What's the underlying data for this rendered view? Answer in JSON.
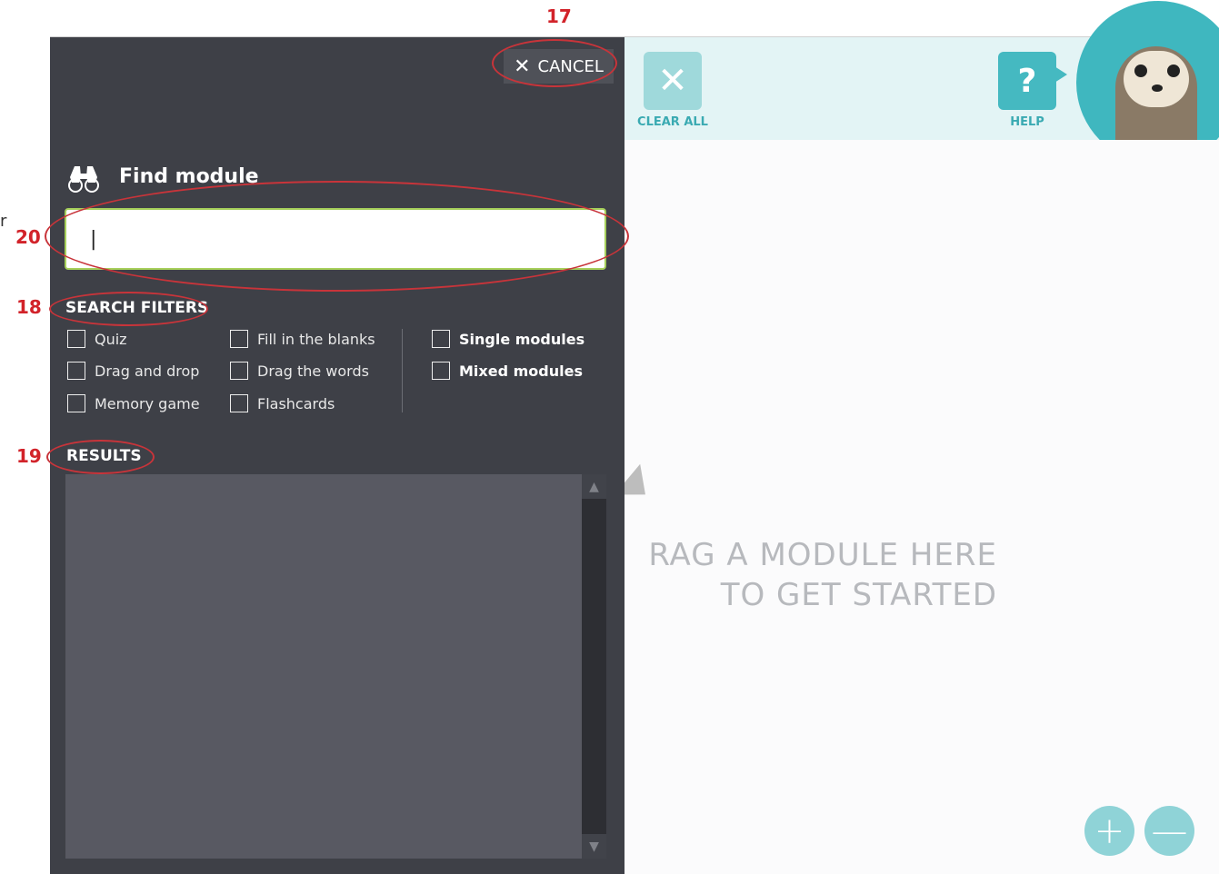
{
  "annotations": {
    "n17": "17",
    "n18": "18",
    "n19": "19",
    "n20": "20",
    "stray_char": "r"
  },
  "toolbar": {
    "clear_all_label": "CLEAR ALL",
    "help_label": "HELP",
    "help_icon_glyph": "?",
    "clear_icon_glyph": "✕"
  },
  "canvas": {
    "drop_text": "RAG A MODULE HERE\nTO GET STARTED",
    "zoom_in_glyph": "+",
    "zoom_out_glyph": "—"
  },
  "panel": {
    "cancel_label": "CANCEL",
    "cancel_icon": "✕",
    "title": "Find module",
    "search_value": "|",
    "filters_heading": "SEARCH FILTERS",
    "filters": [
      {
        "label": "Quiz",
        "checked": false
      },
      {
        "label": "Fill in the blanks",
        "checked": false
      },
      {
        "label": "Single modules",
        "checked": false
      },
      {
        "label": "Drag and drop",
        "checked": false
      },
      {
        "label": "Drag the words",
        "checked": false
      },
      {
        "label": "Mixed modules",
        "checked": false
      },
      {
        "label": "Memory game",
        "checked": false
      },
      {
        "label": "Flashcards",
        "checked": false
      }
    ],
    "results_heading": "RESULTS",
    "scroll_up_glyph": "▲",
    "scroll_down_glyph": "▼"
  },
  "colors": {
    "panel_bg": "#3e4047",
    "accent_teal": "#45b9c1",
    "annotation_red": "#d2232a",
    "input_border": "#a6cf5b"
  }
}
